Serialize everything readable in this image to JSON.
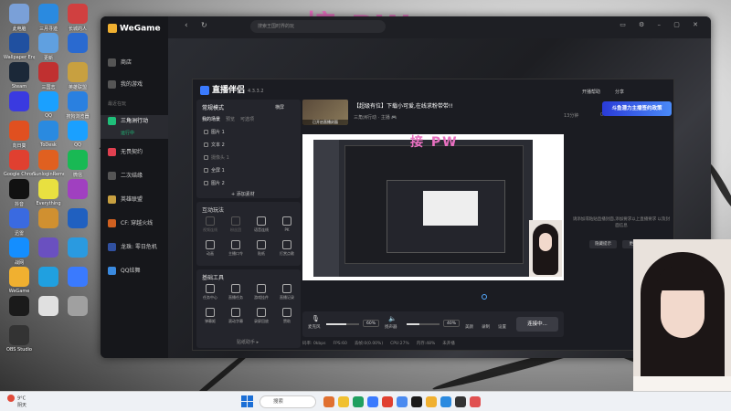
{
  "watermark": {
    "main": "接 PW",
    "preview": "接 PW"
  },
  "desktop": {
    "icons": [
      "此电脑",
      "三月寻迹",
      "长城的人",
      "Wallpaper Engine",
      "更新",
      "",
      "Steam",
      "三国志",
      "英雄联盟",
      "",
      "QQ",
      "搜狗浏览器",
      "向日葵",
      "ToDesk",
      "QQ",
      "Google Chrome",
      "SunloginRemote",
      "微信",
      "抖音",
      "Everything",
      "",
      "迅雷",
      "",
      "",
      "战网",
      "",
      "",
      "WeGame",
      "",
      "",
      "",
      "",
      "",
      "OBS Studio"
    ]
  },
  "wegame": {
    "logo": "WeGame",
    "search_placeholder": "搜索王国时界的玩",
    "nav": [
      {
        "label": "商店"
      },
      {
        "label": "我的游戏"
      },
      {
        "label": "三角洲行动"
      },
      {
        "label": "无畏契约"
      },
      {
        "label": "二次结缘"
      },
      {
        "label": "英雄联盟"
      },
      {
        "label": "CF: 穿越火线"
      },
      {
        "label": "龙珠: 零日危机"
      },
      {
        "label": "QQ炫舞"
      }
    ],
    "active_sub": "运行中",
    "section_label": "最近在玩"
  },
  "zhibo": {
    "title": "直播伴侣",
    "version": "4.3.3.2",
    "mode": "常规模式",
    "mode_btn": "横屏",
    "tabs": [
      "我的场景",
      "预览",
      "可选项"
    ],
    "sources": [
      "图片 1",
      "文本 2",
      "摄像头 1",
      "全屏 1",
      "图片 2"
    ],
    "add_source": "+ 添加素材",
    "interact_title": "互动玩法",
    "interact_tools": [
      "视频连线",
      "粉丝团",
      "语音连线",
      "PK",
      "动画",
      "主播口令",
      "贴纸",
      "打赏点歌"
    ],
    "basic_title": "基础工具",
    "basic_tools": [
      "任务中心",
      "直播任务",
      "游戏挂件",
      "直播记录",
      "弹幕姬",
      "滚动字幕",
      "录屏回放",
      "赞助"
    ],
    "more": "贴纸助手 ▸",
    "room_title": "【超级有位】下载小可爱,在线求粉带带!!",
    "room_sub": "三角洲行动 · 主播 🎮",
    "thumb_label": "已开启直播封面",
    "controls": {
      "mic_label": "麦克风",
      "mic_pct": "60%",
      "speaker_label": "扬声器",
      "speaker_pct": "40%",
      "beauty_label": "美颜",
      "record_label": "录制",
      "settings_label": "设置",
      "go_live": "连接中..."
    },
    "status": [
      "码率: 0kbps",
      "FPS:60",
      "丢帧:0(0.00%)",
      "CPU:27%",
      "内存:48%",
      "未开播"
    ],
    "right": {
      "start_live": "开播帮助",
      "share": "分享",
      "fans_count": "13分钟",
      "likes": "0",
      "viewers": "14411",
      "banner": "斗鱼潜力主播签约政策",
      "tip": "请添加或粘贴直播封面,添加要求以上直播要求 以及封面信息",
      "btn_a": "隐藏提示",
      "btn_b": "更多"
    },
    "colors": {
      "accent": "#3a7afe",
      "watermark": "#e86fc0"
    }
  },
  "taskbar": {
    "weather_temp": "9°C",
    "weather_desc": "阴天",
    "search": "搜索"
  }
}
